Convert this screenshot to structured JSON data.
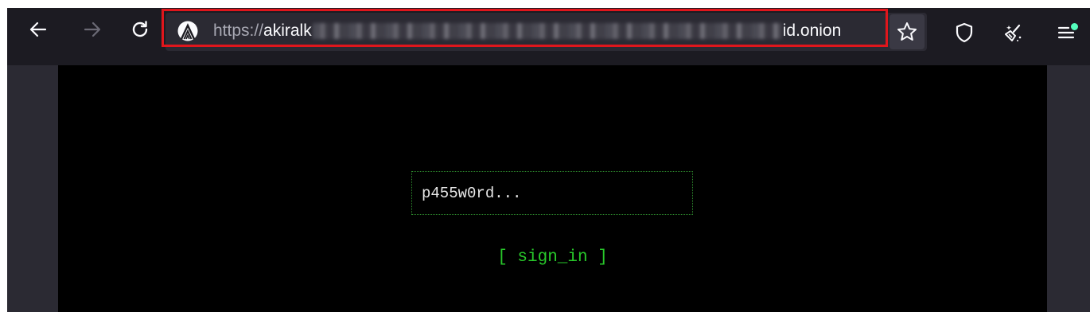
{
  "browser": {
    "nav": {
      "back_icon": "arrow-left-icon",
      "forward_icon": "arrow-right-icon",
      "reload_icon": "reload-icon"
    },
    "urlbar": {
      "site_icon": "onion-circuit-icon",
      "scheme": "https://",
      "host_start": "akiralk",
      "host_end": "id.onion",
      "highlight_color": "#e0161c"
    },
    "toolbar_icons": [
      "star-icon",
      "shield-icon",
      "broom-icon",
      "menu-icon"
    ],
    "menu_badge_color": "#54ffbd"
  },
  "page": {
    "password_placeholder": "p455w0rd...",
    "signin_label": "[ sign_in ]",
    "accent_color": "#28c92a"
  }
}
